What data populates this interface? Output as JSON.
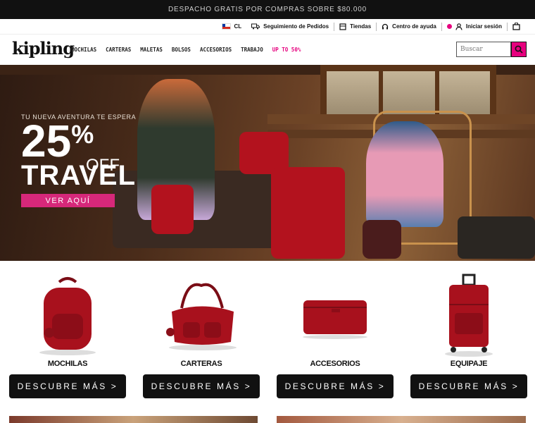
{
  "promo": {
    "text": "DESPACHO GRATIS POR COMPRAS SOBRE $80.000"
  },
  "util": {
    "country": "CL",
    "tracking": "Seguimiento de Pedidos",
    "stores": "Tiendas",
    "help": "Centro de ayuda",
    "login": "Iniciar sesión"
  },
  "brand": {
    "logo": "kipling"
  },
  "nav": {
    "items": [
      "MOCHILAS",
      "CARTERAS",
      "MALETAS",
      "BOLSOS",
      "ACCESORIOS",
      "TRABAJO"
    ],
    "sale": "UP TO 50%"
  },
  "search": {
    "placeholder": "Buscar"
  },
  "hero": {
    "kicker": "TU NUEVA AVENTURA TE ESPERA",
    "pct_number": "25",
    "pct_sign": "%",
    "off": "OFF",
    "headline": "TRAVEL",
    "cta": "VER AQUÍ"
  },
  "categories": [
    {
      "label": "MOCHILAS",
      "button": "DESCUBRE MÁS  >",
      "icon": "backpack-icon"
    },
    {
      "label": "CARTERAS",
      "button": "DESCUBRE MÁS  >",
      "icon": "handbag-icon"
    },
    {
      "label": "ACCESORIOS",
      "button": "DESCUBRE MÁS  >",
      "icon": "wallet-icon"
    },
    {
      "label": "EQUIPAJE",
      "button": "DESCUBRE MÁS  >",
      "icon": "suitcase-icon"
    }
  ],
  "colors": {
    "accent": "#e6007e",
    "product_red": "#b3121e",
    "black": "#111111"
  }
}
